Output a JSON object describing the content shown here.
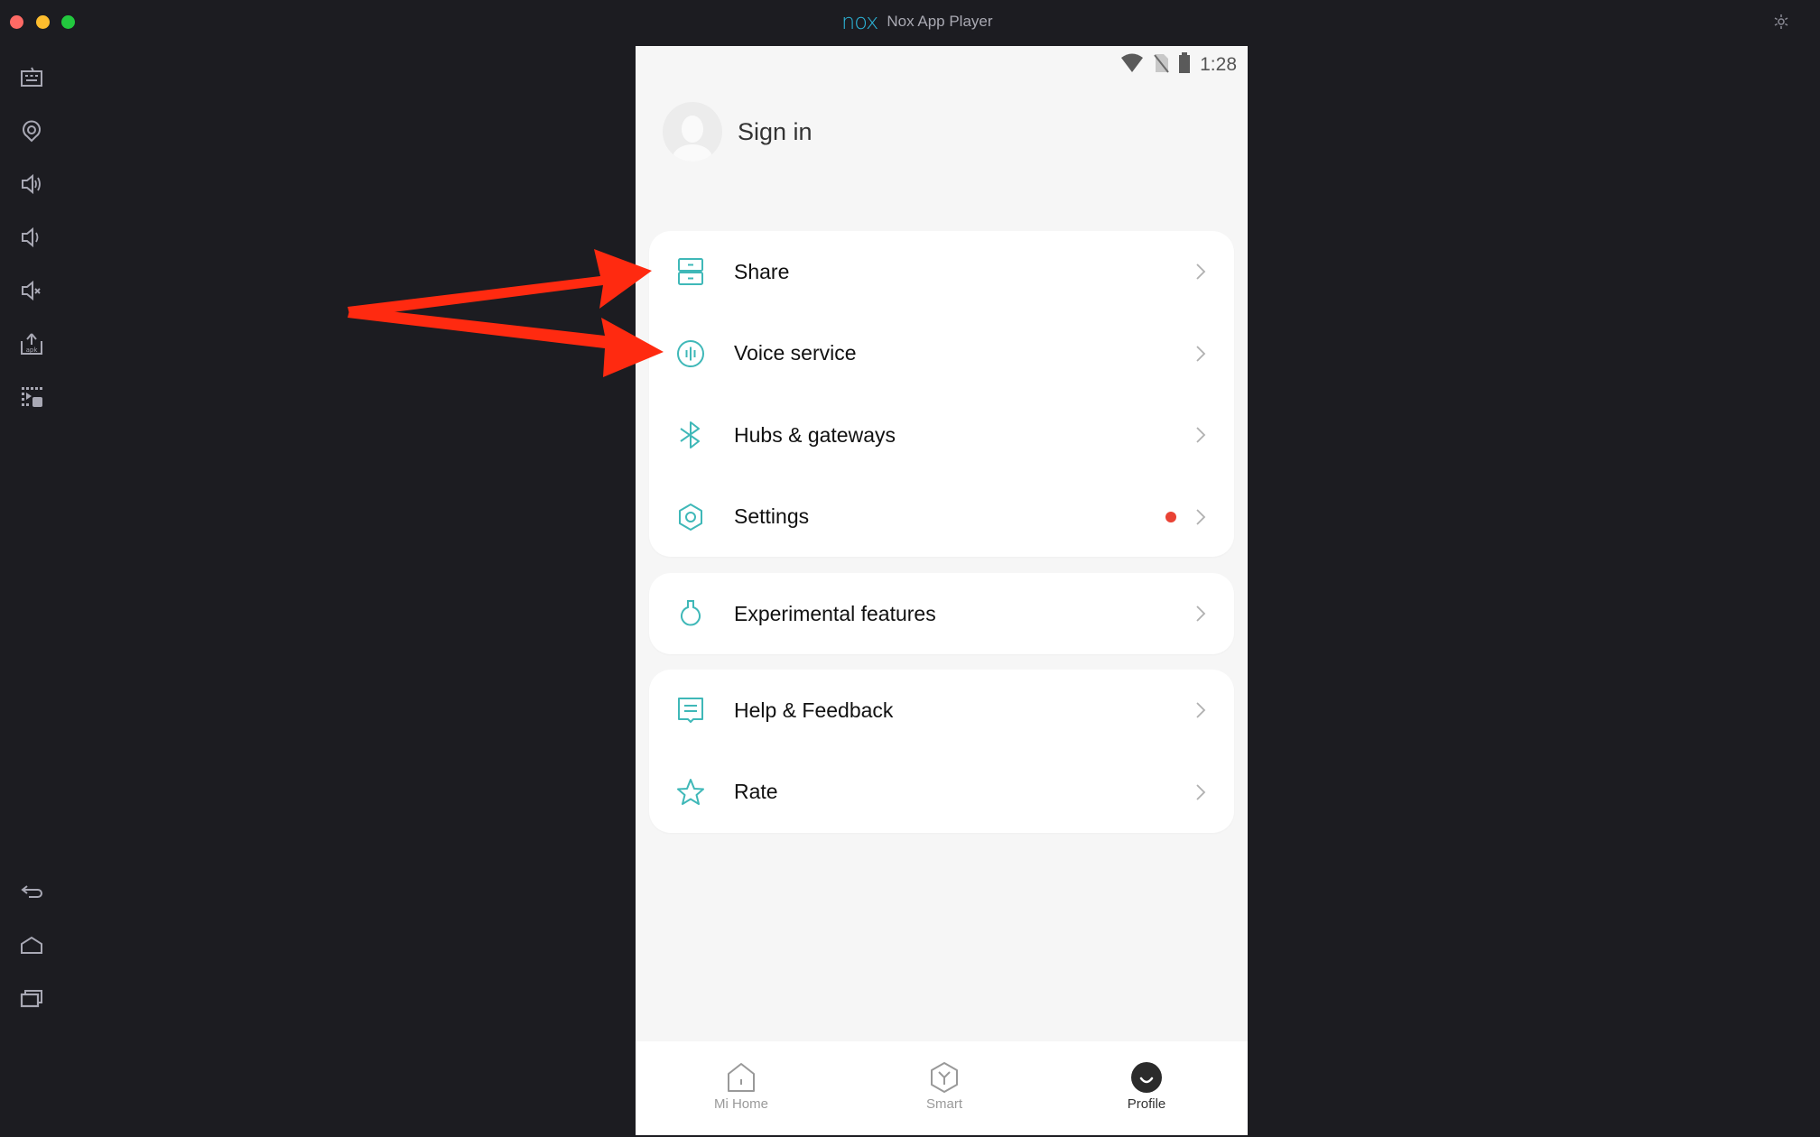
{
  "window": {
    "title": "Nox App Player",
    "logo_text": "nox",
    "controls": [
      "close",
      "minimize",
      "maximize"
    ],
    "settings_icon": "gear-icon"
  },
  "sidebar": {
    "items": [
      {
        "name": "keyboard-mapping-icon"
      },
      {
        "name": "location-icon"
      },
      {
        "name": "volume-up-icon"
      },
      {
        "name": "volume-down-icon"
      },
      {
        "name": "mute-icon"
      },
      {
        "name": "apk-install-icon"
      },
      {
        "name": "multi-instance-icon"
      },
      {
        "name": "back-icon"
      },
      {
        "name": "home-icon"
      },
      {
        "name": "recent-apps-icon"
      }
    ]
  },
  "phone": {
    "status_bar": {
      "time": "1:28",
      "icons": [
        "wifi-icon",
        "no-sim-icon",
        "battery-icon"
      ]
    },
    "profile": {
      "sign_in_label": "Sign in"
    },
    "menu_groups": [
      [
        {
          "label": "Share",
          "icon": "share-icon"
        },
        {
          "label": "Voice service",
          "icon": "voice-icon"
        },
        {
          "label": "Hubs & gateways",
          "icon": "bluetooth-icon"
        },
        {
          "label": "Settings",
          "icon": "settings-hex-icon",
          "badge": true
        }
      ],
      [
        {
          "label": "Experimental features",
          "icon": "flask-icon"
        }
      ],
      [
        {
          "label": "Help & Feedback",
          "icon": "feedback-icon"
        },
        {
          "label": "Rate",
          "icon": "star-icon"
        }
      ]
    ],
    "bottom_nav": [
      {
        "label": "Mi Home",
        "active": false
      },
      {
        "label": "Smart",
        "active": false
      },
      {
        "label": "Profile",
        "active": true
      }
    ]
  },
  "colors": {
    "accent": "#3fb8b8",
    "badge": "#e94234",
    "annotation_arrow": "#ff2a10",
    "window_bg": "#1c1c21"
  },
  "annotations": {
    "arrows_point_to": [
      "Share",
      "Voice service"
    ]
  }
}
